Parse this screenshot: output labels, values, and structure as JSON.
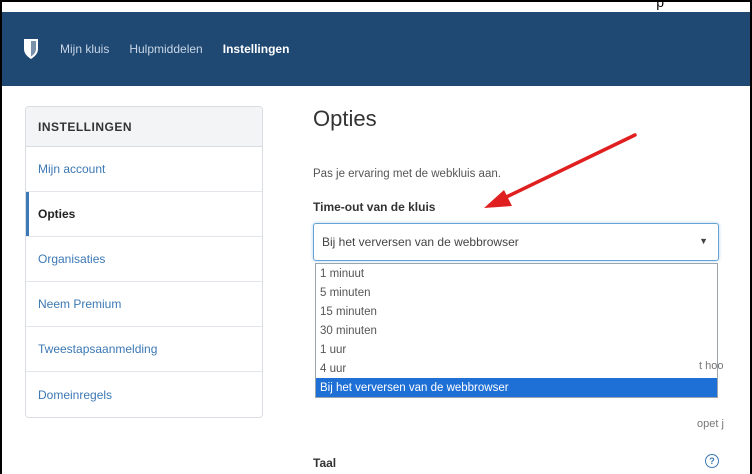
{
  "top_crop_text": "p",
  "nav": {
    "links": [
      {
        "label": "Mijn kluis"
      },
      {
        "label": "Hulpmiddelen"
      },
      {
        "label": "Instellingen"
      }
    ]
  },
  "sidebar": {
    "header": "INSTELLINGEN",
    "items": [
      {
        "label": "Mijn account"
      },
      {
        "label": "Opties"
      },
      {
        "label": "Organisaties"
      },
      {
        "label": "Neem Premium"
      },
      {
        "label": "Tweestapsaanmelding"
      },
      {
        "label": "Domeinregels"
      }
    ]
  },
  "main": {
    "title": "Opties",
    "subtitle": "Pas je ervaring met de webkluis aan.",
    "timeout_label": "Time-out van de kluis",
    "timeout_selected": "Bij het verversen van de webbrowser",
    "timeout_options": [
      "1 minuut",
      "5 minuten",
      "15 minuten",
      "30 minuten",
      "1 uur",
      "4 uur",
      "Bij het verversen van de webbrowser"
    ],
    "behind_text_1": "t hoo",
    "behind_text_2": "opet j",
    "language_label": "Taal"
  },
  "colors": {
    "navbar": "#1f4873",
    "link": "#3c78b4",
    "selected_option": "#1e6fd6",
    "annotation_arrow": "#e02020"
  },
  "icons": {
    "logo": "shield-icon",
    "caret": "caret-down-icon",
    "help": "question-circle-icon"
  }
}
